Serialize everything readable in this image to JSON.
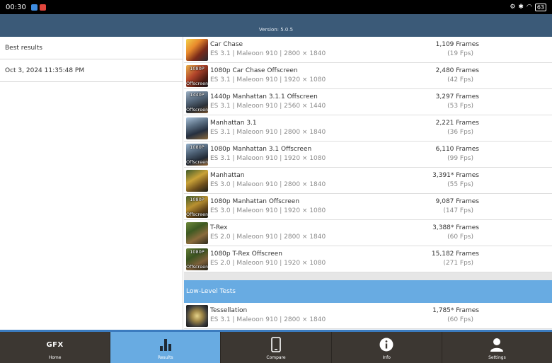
{
  "status_bar": {
    "time": "00:30",
    "battery": "63"
  },
  "header": {
    "version": "Version: 5.0.5"
  },
  "left_panel": {
    "best_results": "Best results",
    "timestamp": "Oct 3, 2024 11:35:48 PM"
  },
  "results": [
    {
      "name": "Car Chase",
      "details": "ES 3.1 | Maleoon 910 | 2800 × 1840",
      "frames": "1,109 Frames",
      "fps": "(19 Fps)",
      "thumb_top": "",
      "thumb_bottom": ""
    },
    {
      "name": "1080p Car Chase Offscreen",
      "details": "ES 3.1 | Maleoon 910 | 1920 × 1080",
      "frames": "2,480 Frames",
      "fps": "(42 Fps)",
      "thumb_top": "1080P",
      "thumb_bottom": "Offscreen"
    },
    {
      "name": "1440p Manhattan 3.1.1 Offscreen",
      "details": "ES 3.1 | Maleoon 910 | 2560 × 1440",
      "frames": "3,297 Frames",
      "fps": "(53 Fps)",
      "thumb_top": "1440P",
      "thumb_bottom": "Offscreen"
    },
    {
      "name": "Manhattan 3.1",
      "details": "ES 3.1 | Maleoon 910 | 2800 × 1840",
      "frames": "2,221 Frames",
      "fps": "(36 Fps)",
      "thumb_top": "",
      "thumb_bottom": ""
    },
    {
      "name": "1080p Manhattan 3.1 Offscreen",
      "details": "ES 3.1 | Maleoon 910 | 1920 × 1080",
      "frames": "6,110 Frames",
      "fps": "(99 Fps)",
      "thumb_top": "1080P",
      "thumb_bottom": "Offscreen"
    },
    {
      "name": "Manhattan",
      "details": "ES 3.0 | Maleoon 910 | 2800 × 1840",
      "frames": "3,391* Frames",
      "fps": "(55 Fps)",
      "thumb_top": "",
      "thumb_bottom": ""
    },
    {
      "name": "1080p Manhattan Offscreen",
      "details": "ES 3.0 | Maleoon 910 | 1920 × 1080",
      "frames": "9,087 Frames",
      "fps": "(147 Fps)",
      "thumb_top": "1080P",
      "thumb_bottom": "Offscreen"
    },
    {
      "name": "T-Rex",
      "details": "ES 2.0 | Maleoon 910 | 2800 × 1840",
      "frames": "3,388* Frames",
      "fps": "(60 Fps)",
      "thumb_top": "",
      "thumb_bottom": ""
    },
    {
      "name": "1080p T-Rex Offscreen",
      "details": "ES 2.0 | Maleoon 910 | 1920 × 1080",
      "frames": "15,182 Frames",
      "fps": "(271 Fps)",
      "thumb_top": "1080P",
      "thumb_bottom": "Offscreen"
    }
  ],
  "low_level": {
    "title": "Low-Level Tests",
    "items": [
      {
        "name": "Tessellation",
        "details": "ES 3.1 | Maleoon 910 | 2800 × 1840",
        "frames": "1,785* Frames",
        "fps": "(60 Fps)"
      }
    ]
  },
  "bottom_nav": {
    "home_logo": "GFX",
    "home": "Home",
    "results": "Results",
    "compare": "Compare",
    "info": "Info",
    "settings": "Settings"
  },
  "colors": {
    "header": "#3b5a78",
    "accent": "#68abe2",
    "nav_bg": "#3c3732"
  }
}
